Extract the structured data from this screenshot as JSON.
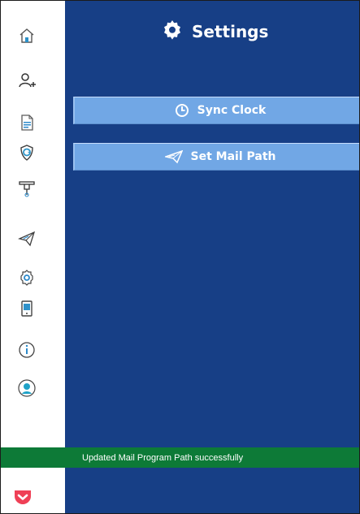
{
  "header": {
    "title": "Settings",
    "title_icon": "gear-icon"
  },
  "actions": {
    "sync_clock": {
      "label": "Sync Clock",
      "icon": "clock-icon"
    },
    "set_mail_path": {
      "label": "Set Mail Path",
      "icon": "paper-plane-icon"
    }
  },
  "status": {
    "message": "Updated Mail Program Path successfully"
  },
  "sidebar": {
    "items": [
      {
        "icon": "home-icon"
      },
      {
        "icon": "add-user-icon"
      },
      {
        "icon": "document-icon"
      },
      {
        "icon": "shield-icon"
      },
      {
        "icon": "tool-icon"
      },
      {
        "icon": "paper-plane-icon"
      },
      {
        "icon": "gear-icon"
      },
      {
        "icon": "mobile-device-icon"
      },
      {
        "icon": "info-icon"
      },
      {
        "icon": "user-profile-icon"
      }
    ],
    "bottom_icon": "pocket-icon"
  },
  "colors": {
    "main_background": "#173f86",
    "button_background": "#71a7e5",
    "status_bar": "#0d7a37",
    "sidebar_background": "#ffffff",
    "pocket_red": "#ef4056"
  }
}
